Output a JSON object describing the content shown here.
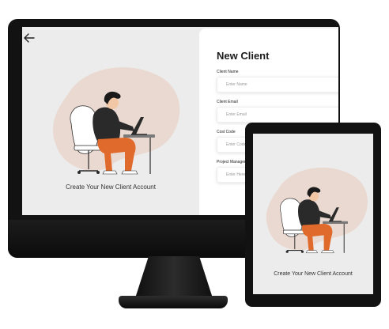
{
  "colors": {
    "device_frame": "#121212",
    "screen_bg": "#ececec",
    "blob": "#ead9d0",
    "pants": "#e06a2b",
    "shirt": "#2a2a2a",
    "hair": "#1a1a1a",
    "chair": "#ffffff"
  },
  "desktop": {
    "back_icon": "arrow-left-icon",
    "caption": "Create Your New Client Account",
    "form": {
      "title": "New Client",
      "fields": [
        {
          "label": "Client Name",
          "placeholder": "Enter Name"
        },
        {
          "label": "Client Email",
          "placeholder": "Enter Email"
        },
        {
          "label": "Cost Code",
          "placeholder": "Enter Code"
        },
        {
          "label": "Project Manager",
          "placeholder": "Enter Here"
        }
      ]
    }
  },
  "tablet": {
    "caption": "Create Your New Client Account"
  }
}
